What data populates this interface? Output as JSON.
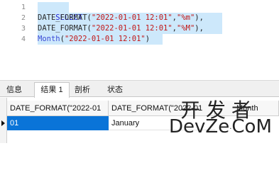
{
  "editor": {
    "line_numbers": [
      "1",
      "2",
      "3",
      "4"
    ],
    "lines": [
      {
        "t1": "SELECT"
      },
      {
        "fn": "DATE_FORMAT",
        "open": "(",
        "arg": "\"2022-01-01 12:01\"",
        "comma": ",",
        "fmt": "\"%m\"",
        "close": "),"
      },
      {
        "fn": "DATE_FORMAT",
        "open": "(",
        "arg": "\"2022-01-01 12:01\"",
        "comma": ",",
        "fmt": "\"%M\"",
        "close": "),"
      },
      {
        "fn": "Month",
        "open": "(",
        "arg": "\"2022-01-01 12:01\"",
        "close": ")"
      }
    ]
  },
  "tabs": [
    {
      "label": "信息"
    },
    {
      "label": "结果 1"
    },
    {
      "label": "剖析"
    },
    {
      "label": "状态"
    }
  ],
  "grid": {
    "columns": [
      "DATE_FORMAT(\"2022-01",
      "DATE_FORMAT(\"2022-01",
      "Month"
    ],
    "rows": [
      [
        "01",
        "January"
      ]
    ]
  },
  "watermark": {
    "top": "开发者",
    "bottom_left": "DevZe",
    "dot": ".",
    "bottom_right": "CoM"
  }
}
